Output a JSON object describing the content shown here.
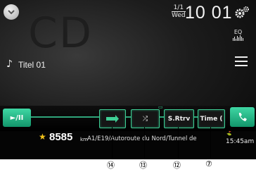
{
  "background_label": "CD",
  "date": {
    "fraction": "1/1",
    "weekday": "Wed"
  },
  "clock": "10 01",
  "eq_label": "EQ",
  "track_title": "Titel 01",
  "play_pause_label": "►/II",
  "buttons": {
    "b14_icon": "repeat-icon",
    "b13_label": "⤮",
    "b12_label": "S.Rtrv",
    "b7_label": "Time ("
  },
  "nav": {
    "distance": "8585",
    "unit": "km",
    "road": "A1/E19/Autoroute du Nord/Tunnel de",
    "eta": "15:45am"
  },
  "callouts": [
    "⑭",
    "⑬",
    "⑫",
    "⑦"
  ],
  "colors": {
    "accent": "#3fcf95",
    "star": "#f3c21a"
  }
}
